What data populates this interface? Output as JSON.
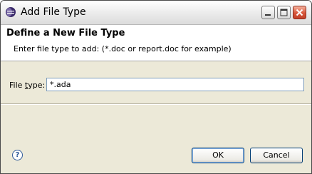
{
  "window": {
    "title": "Add File Type",
    "controls": [
      "minimize",
      "maximize",
      "close"
    ]
  },
  "header": {
    "title": "Define a New File Type",
    "message": "Enter file type to add: (*.doc or report.doc for example)"
  },
  "form": {
    "file_type_label_prefix": "File ",
    "file_type_label_mnemonic": "t",
    "file_type_label_suffix": "ype:",
    "file_type_value": "*.ada"
  },
  "footer": {
    "help_icon": "question-mark-icon",
    "ok_label": "OK",
    "cancel_label": "Cancel"
  }
}
